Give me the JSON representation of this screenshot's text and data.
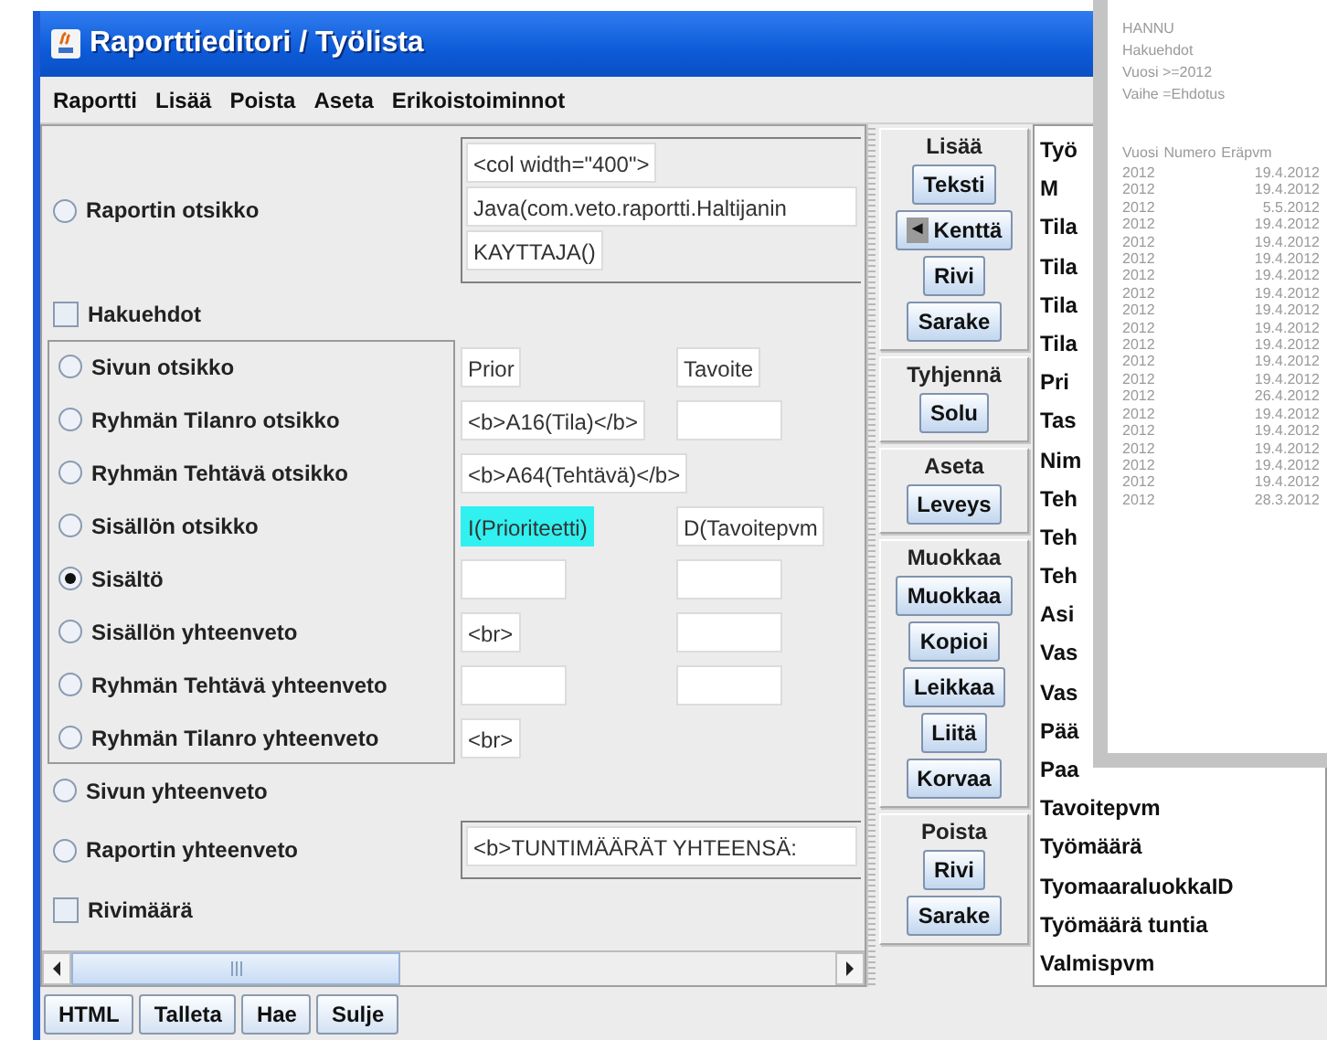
{
  "window": {
    "title": "Raporttieditori / Työlista"
  },
  "menu": [
    "Raportti",
    "Lisää",
    "Poista",
    "Aseta",
    "Erikoistoiminnot"
  ],
  "sections": [
    {
      "kind": "radio",
      "label": "Raportin otsikko",
      "selected": false,
      "block": [
        {
          "value": "<col width=\"400\">",
          "selected": false
        },
        {
          "value": "Java(com.veto.raportti.Haltijanin",
          "selected": false
        },
        {
          "value": "KAYTTAJA()",
          "selected": false
        }
      ]
    },
    {
      "kind": "checkbox",
      "label": "Hakuehdot",
      "checked": false
    },
    {
      "kind": "group",
      "items": [
        {
          "kind": "radio",
          "label": "Sivun otsikko",
          "selected": false,
          "fields": [
            {
              "value": "Prior",
              "selected": false
            },
            {
              "value": "Tavoite",
              "selected": false
            }
          ]
        },
        {
          "kind": "radio",
          "label": "Ryhmän Tilanro otsikko",
          "selected": false,
          "fields": [
            {
              "value": "<b>A16(Tila)</b>",
              "selected": false
            },
            {
              "selected": false
            }
          ]
        },
        {
          "kind": "radio",
          "label": "Ryhmän Tehtävä otsikko",
          "selected": false,
          "fields": [
            {
              "value": "<b>A64(Tehtävä)</b>",
              "selected": false
            }
          ]
        },
        {
          "kind": "radio",
          "label": "Sisällön otsikko",
          "selected": false,
          "fields": [
            {
              "value": "I(Prioriteetti)",
              "selected": true
            },
            {
              "value": "D(Tavoitepvm",
              "selected": false
            }
          ]
        },
        {
          "kind": "radio",
          "label": "Sisältö",
          "selected": true,
          "fields": [
            {
              "selected": false
            },
            {
              "selected": false
            }
          ]
        },
        {
          "kind": "radio",
          "label": "Sisällön yhteenveto",
          "selected": false,
          "fields": [
            {
              "value": "<br>",
              "selected": false
            },
            {
              "selected": false
            }
          ]
        },
        {
          "kind": "radio",
          "label": "Ryhmän Tehtävä yhteenveto",
          "selected": false,
          "fields": [
            {
              "selected": false
            },
            {
              "selected": false
            }
          ]
        },
        {
          "kind": "radio",
          "label": "Ryhmän Tilanro yhteenveto",
          "selected": false,
          "fields": [
            {
              "value": "<br>",
              "selected": false
            }
          ]
        }
      ]
    },
    {
      "kind": "radio",
      "label": "Sivun yhteenveto",
      "selected": false
    },
    {
      "kind": "radio",
      "label": "Raportin yhteenveto",
      "selected": false,
      "block": [
        {
          "value": "<b>TUNTIMÄÄRÄT YHTEENSÄ:",
          "selected": false
        }
      ]
    },
    {
      "kind": "checkbox",
      "label": "Rivimäärä",
      "checked": false
    }
  ],
  "tool_groups": [
    {
      "title": "Lisää",
      "buttons": [
        {
          "label": "Teksti"
        },
        {
          "label": "Kenttä",
          "prefix": "◄"
        },
        {
          "label": "Rivi"
        },
        {
          "label": "Sarake"
        }
      ]
    },
    {
      "title": "Tyhjennä",
      "buttons": [
        {
          "label": "Solu"
        }
      ]
    },
    {
      "title": "Aseta",
      "buttons": [
        {
          "label": "Leveys"
        }
      ]
    },
    {
      "title": "Muokkaa",
      "buttons": [
        {
          "label": "Muokkaa"
        },
        {
          "label": "Kopioi"
        },
        {
          "label": "Leikkaa"
        },
        {
          "label": "Liitä"
        },
        {
          "label": "Korvaa"
        }
      ]
    },
    {
      "title": "Poista",
      "buttons": [
        {
          "label": "Rivi"
        },
        {
          "label": "Sarake"
        }
      ]
    }
  ],
  "field_list": [
    "Työ",
    "M",
    "Tila",
    "Tila",
    "Tila",
    "Tila",
    "Pri",
    "Tas",
    "Nim",
    "Teh",
    "Teh",
    "Teh",
    "Asi",
    "Vas",
    "Vas",
    "Pää",
    "Paa",
    "Tavoitepvm",
    "Työmäärä",
    "TyomaaraluokkaID",
    "Työmäärä tuntia",
    "Valmispvm"
  ],
  "preview": {
    "lines": [
      "HANNU",
      "Hakuehdot",
      "Vuosi >=2012",
      "Vaihe =Ehdotus"
    ],
    "columns": [
      "Vuosi",
      "Numero",
      "Eräpvm"
    ],
    "rows": [
      {
        "year": "2012",
        "date": "19.4.2012"
      },
      {
        "year": "2012",
        "date": "19.4.2012"
      },
      {
        "year": "2012",
        "date": "5.5.2012"
      },
      {
        "year": "2012",
        "date": "19.4.2012"
      },
      {
        "year": "2012",
        "date": "19.4.2012"
      },
      {
        "year": "2012",
        "date": "19.4.2012"
      },
      {
        "year": "2012",
        "date": "19.4.2012"
      },
      {
        "year": "2012",
        "date": "19.4.2012"
      },
      {
        "year": "2012",
        "date": "19.4.2012"
      },
      {
        "year": "2012",
        "date": "19.4.2012"
      },
      {
        "year": "2012",
        "date": "19.4.2012"
      },
      {
        "year": "2012",
        "date": "19.4.2012"
      },
      {
        "year": "2012",
        "date": "19.4.2012"
      },
      {
        "year": "2012",
        "date": "26.4.2012"
      },
      {
        "year": "2012",
        "date": "19.4.2012"
      },
      {
        "year": "2012",
        "date": "19.4.2012"
      },
      {
        "year": "2012",
        "date": "19.4.2012"
      },
      {
        "year": "2012",
        "date": "19.4.2012"
      },
      {
        "year": "2012",
        "date": "19.4.2012"
      },
      {
        "year": "2012",
        "date": "28.3.2012"
      }
    ]
  },
  "bottom_buttons": [
    "HTML",
    "Talleta",
    "Hae",
    "Sulje"
  ]
}
